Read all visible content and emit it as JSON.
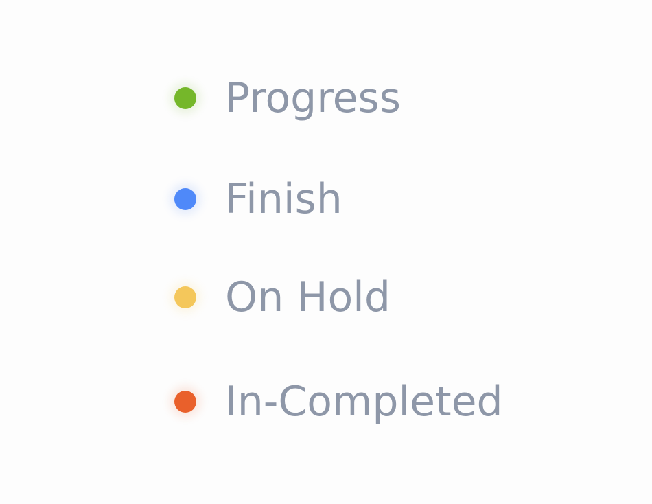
{
  "legend": {
    "items": [
      {
        "label": "Progress",
        "color": "#75b72a"
      },
      {
        "label": "Finish",
        "color": "#4f89f9"
      },
      {
        "label": "On Hold",
        "color": "#f4c75b"
      },
      {
        "label": "In-Completed",
        "color": "#e9602b"
      }
    ]
  }
}
